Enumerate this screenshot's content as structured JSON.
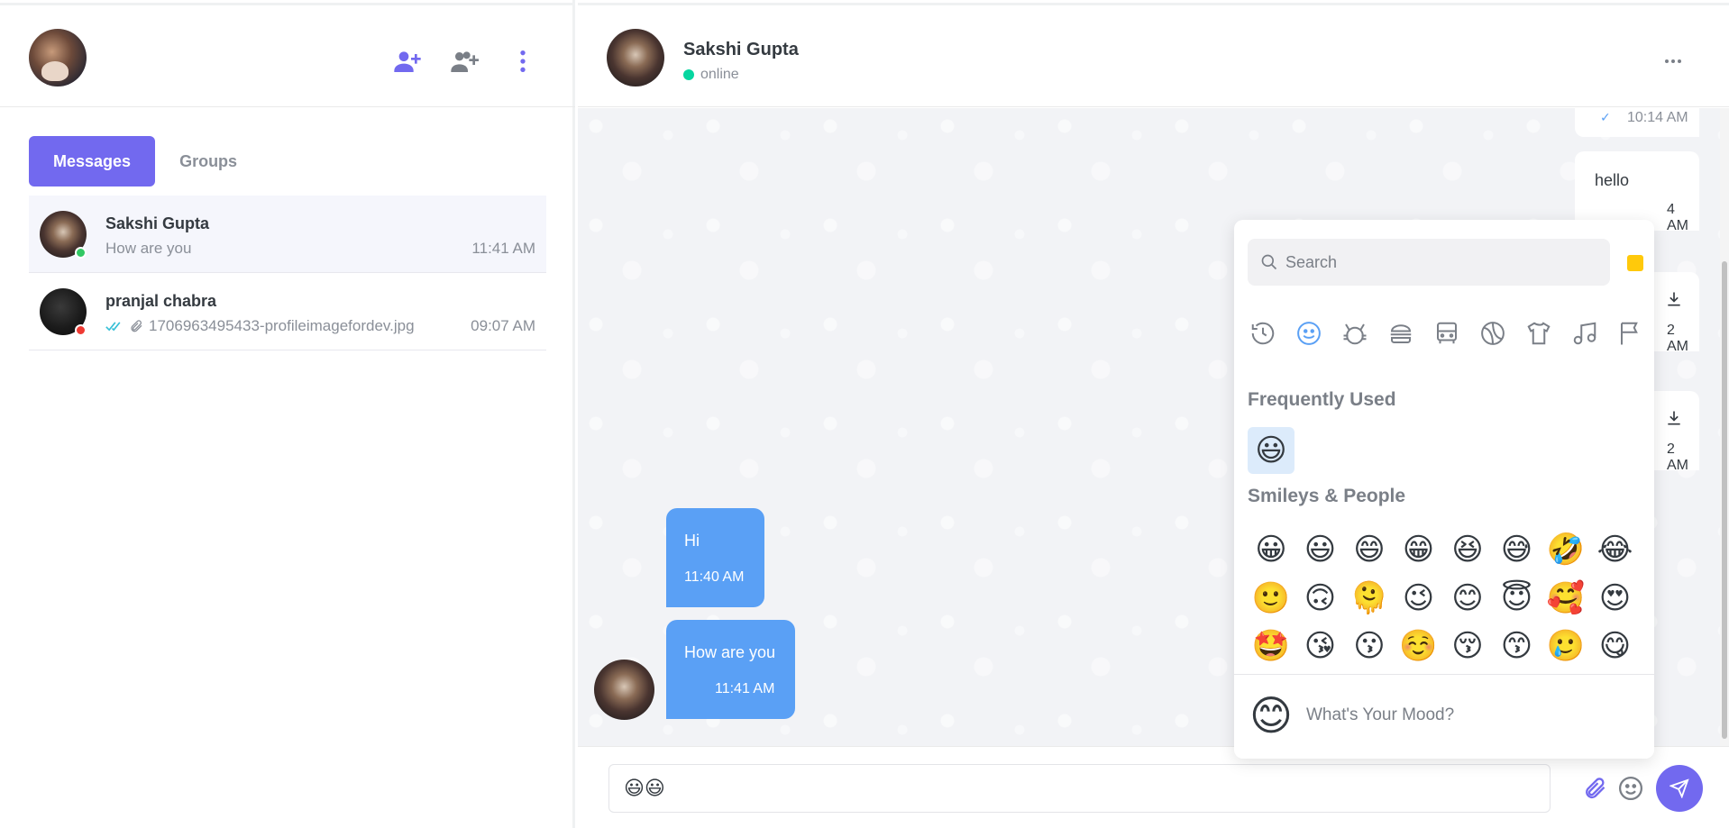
{
  "sidebar": {
    "tabs": [
      {
        "label": "Messages",
        "active": true
      },
      {
        "label": "Groups",
        "active": false
      }
    ],
    "icons": [
      "add-user-icon",
      "add-group-icon",
      "more-vertical-icon"
    ],
    "conversations": [
      {
        "name": "Sakshi Gupta",
        "preview": "How are you",
        "time": "11:41 AM",
        "status": "online"
      },
      {
        "name": "pranjal chabra",
        "preview": "1706963495433-profileimagefordev.jpg",
        "time": "09:07 AM",
        "status": "offline"
      }
    ]
  },
  "header": {
    "name": "Sakshi Gupta",
    "status": "online"
  },
  "messages": {
    "right": [
      {
        "text": "",
        "time": "10:14 AM"
      },
      {
        "text": "hello",
        "time": "4 AM"
      },
      {
        "text": "",
        "time": "2 AM"
      },
      {
        "text": "",
        "time": "2 AM"
      }
    ],
    "left": [
      {
        "text": "Hi",
        "time": "11:40 AM"
      },
      {
        "text": "How are you",
        "time": "11:41 AM"
      }
    ]
  },
  "composer": {
    "value": "😃😃"
  },
  "emoji_picker": {
    "search_placeholder": "Search",
    "frequently_used_title": "Frequently Used",
    "smileys_title": "Smileys & People",
    "frequently_used": [
      "😃"
    ],
    "smileys": [
      "😀",
      "😃",
      "😄",
      "😁",
      "😆",
      "😅",
      "🤣",
      "😂",
      "🙂",
      "🙃",
      "🫠",
      "😉",
      "😊",
      "😇",
      "🥰",
      "😍",
      "🤩",
      "😘",
      "😗",
      "☺️",
      "😚",
      "😙",
      "🥲",
      "😋"
    ],
    "preview_emoji": "😊",
    "mood_placeholder": "What's Your Mood?",
    "skin_tone_color": "#ffc90b"
  },
  "colors": {
    "accent": "#7269ef",
    "bubble": "#5aa0f5",
    "online": "#06d6a0"
  }
}
